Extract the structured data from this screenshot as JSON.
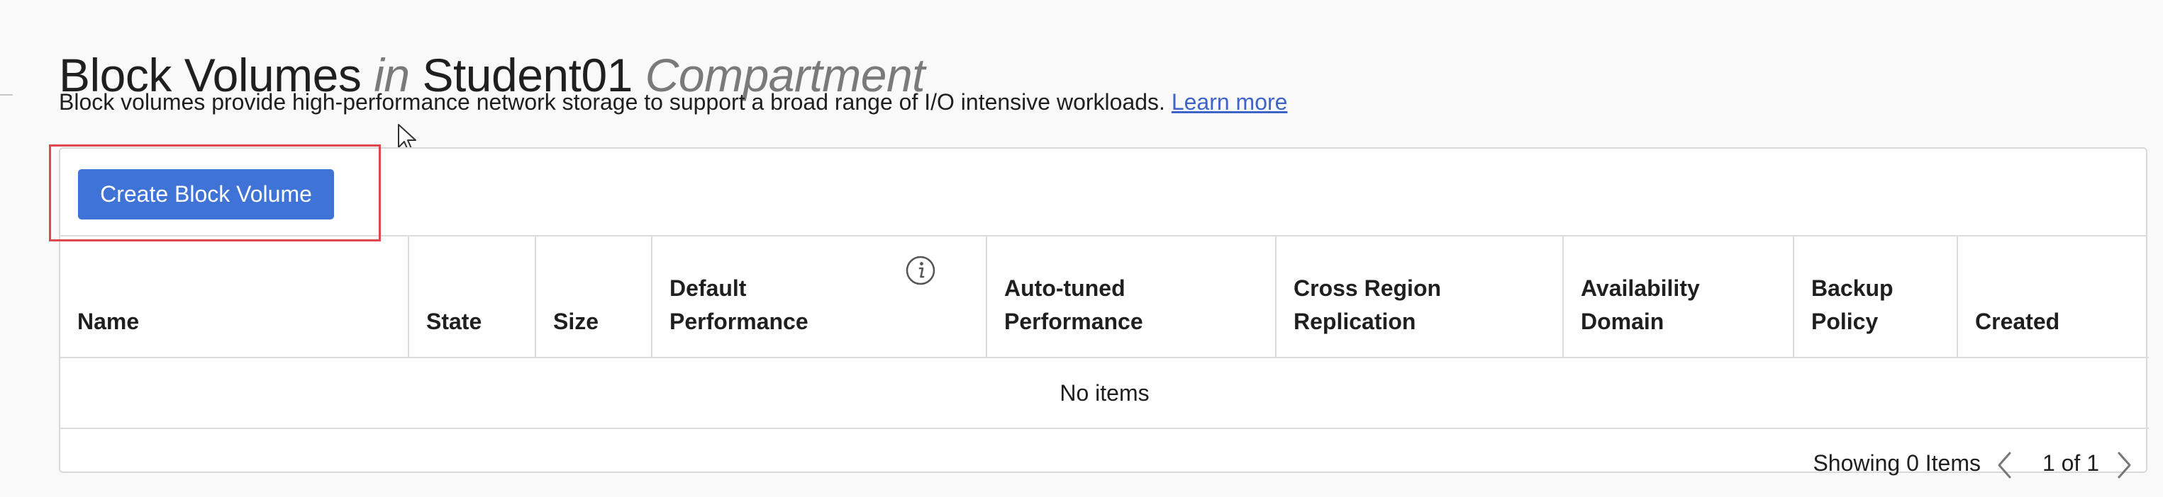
{
  "header": {
    "title_resource": "Block Volumes",
    "title_in": "in",
    "title_compartment_name": "Student01",
    "title_compartment_word": "Compartment"
  },
  "description": {
    "text": "Block volumes provide high-performance network storage to support a broad range of I/O intensive workloads.",
    "link_label": "Learn more"
  },
  "toolbar": {
    "create_label": "Create Block Volume"
  },
  "table": {
    "columns": [
      {
        "line1": "",
        "line2": "Name"
      },
      {
        "line1": "",
        "line2": "State"
      },
      {
        "line1": "",
        "line2": "Size"
      },
      {
        "line1": "Default",
        "line2": "Performance"
      },
      {
        "line1": "Auto-tuned",
        "line2": "Performance"
      },
      {
        "line1": "Cross Region",
        "line2": "Replication"
      },
      {
        "line1": "Availability",
        "line2": "Domain"
      },
      {
        "line1": "Backup",
        "line2": "Policy"
      },
      {
        "line1": "",
        "line2": "Created"
      }
    ],
    "empty_text": "No items"
  },
  "footer": {
    "showing_text": "Showing 0 Items",
    "page_text": "1 of 1"
  },
  "colors": {
    "primary_button": "#3f74d6",
    "link": "#3f64c8",
    "highlight": "#e0474c"
  }
}
